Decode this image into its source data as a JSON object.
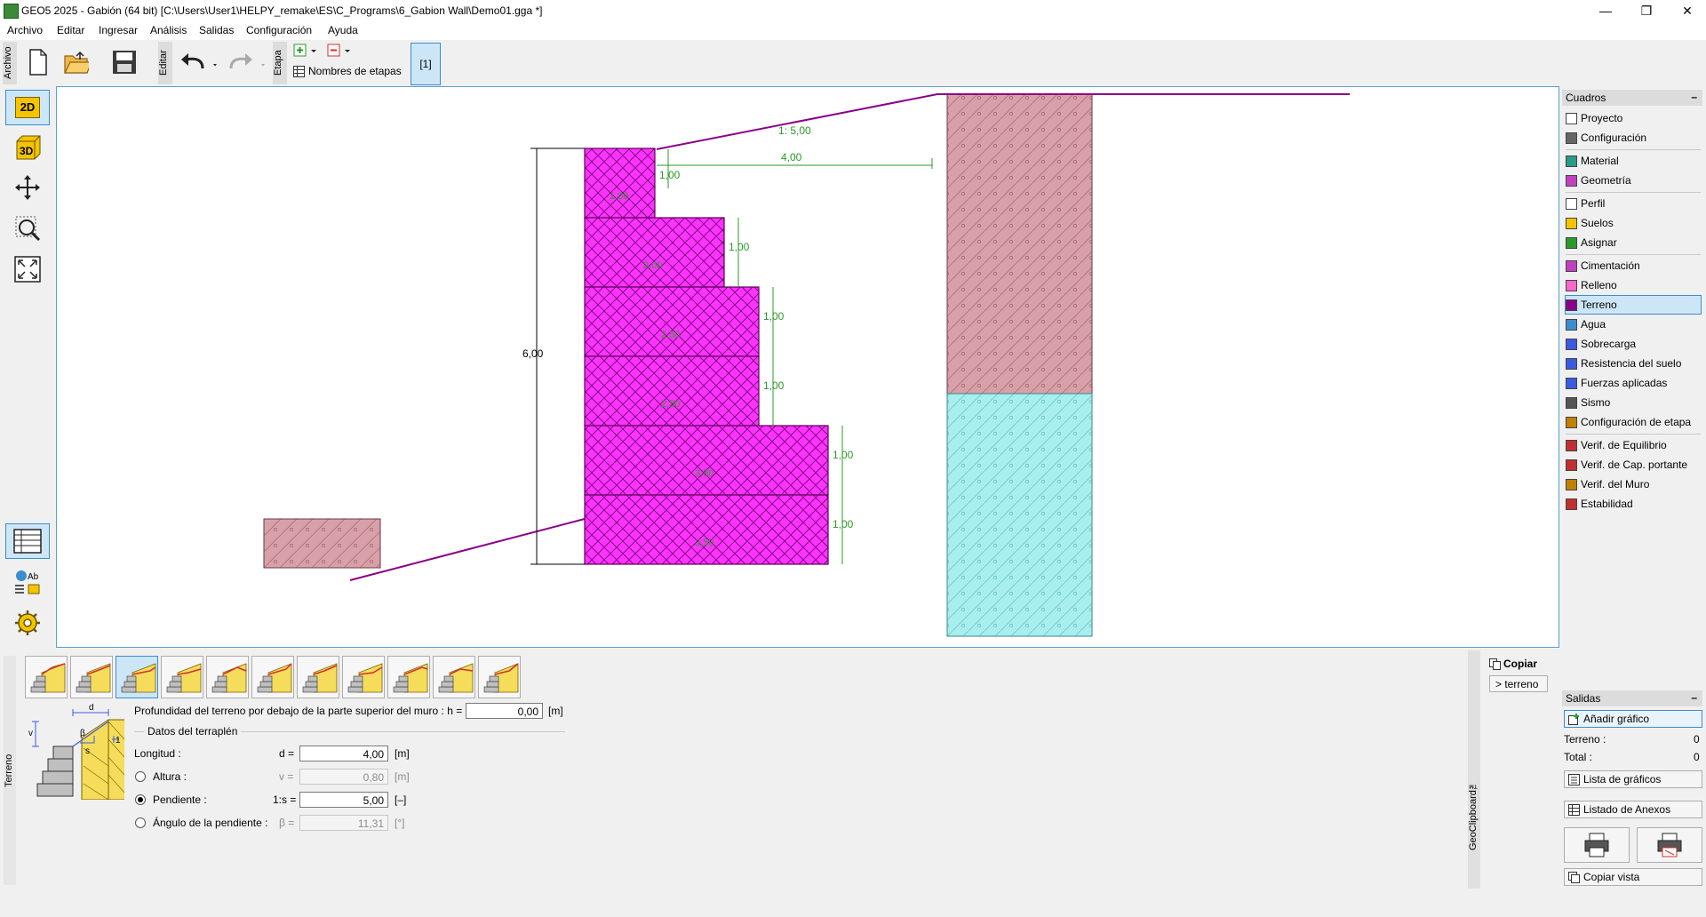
{
  "window": {
    "title": "GEO5 2025 - Gabión (64 bit) [C:\\Users\\User1\\HELPY_remake\\ES\\C_Programs\\6_Gabion Wall\\Demo01.gga *]"
  },
  "menu": [
    "Archivo",
    "Editar",
    "Ingresar",
    "Análisis",
    "Salidas",
    "Configuración",
    "Ayuda"
  ],
  "toolbar": {
    "archivo_label": "Archivo",
    "editar_label": "Editar",
    "etapa_label": "Etapa",
    "stage_names_label": "Nombres de etapas",
    "stage_tab": "[1]"
  },
  "leftbar": {
    "btn_2d": "2D",
    "btn_3d": "3D"
  },
  "drawing": {
    "slope_label": "1: 5,00",
    "length_label": "4,00",
    "total_height": "6,00",
    "step_heights": [
      "1,00",
      "1,00",
      "1,00",
      "1,00",
      "1,00",
      "1,00"
    ],
    "block_widths": [
      "1,00",
      "2,00",
      "2,50",
      "2,50",
      "3,50",
      "3,50"
    ]
  },
  "right_panel": {
    "cuadros_title": "Cuadros",
    "groups": [
      [
        {
          "label": "Proyecto",
          "icon": "project-icon"
        },
        {
          "label": "Configuración",
          "icon": "gear-icon"
        }
      ],
      [
        {
          "label": "Material",
          "icon": "material-icon"
        },
        {
          "label": "Geometría",
          "icon": "geometry-icon"
        }
      ],
      [
        {
          "label": "Perfil",
          "icon": "profile-icon"
        },
        {
          "label": "Suelos",
          "icon": "soils-icon"
        },
        {
          "label": "Asignar",
          "icon": "assign-icon"
        }
      ],
      [
        {
          "label": "Cimentación",
          "icon": "foundation-icon"
        },
        {
          "label": "Relleno",
          "icon": "backfill-icon"
        },
        {
          "label": "Terreno",
          "icon": "terrain-icon",
          "selected": true
        },
        {
          "label": "Agua",
          "icon": "water-icon"
        },
        {
          "label": "Sobrecarga",
          "icon": "surcharge-icon"
        },
        {
          "label": "Resistencia del suelo",
          "icon": "resistance-icon"
        },
        {
          "label": "Fuerzas aplicadas",
          "icon": "forces-icon"
        },
        {
          "label": "Sismo",
          "icon": "earthquake-icon"
        },
        {
          "label": "Configuración de etapa",
          "icon": "stage-settings-icon"
        }
      ],
      [
        {
          "label": "Verif. de Equilibrio",
          "icon": "equilibrium-icon"
        },
        {
          "label": "Verif. de Cap. portante",
          "icon": "bearing-icon"
        },
        {
          "label": "Verif. del Muro",
          "icon": "wall-check-icon"
        },
        {
          "label": "Estabilidad",
          "icon": "stability-icon"
        }
      ]
    ],
    "salidas_title": "Salidas",
    "add_graphic": "Añadir gráfico",
    "terreno_label": "Terreno :",
    "terreno_count": "0",
    "total_label": "Total :",
    "total_count": "0",
    "graphics_list": "Lista de gráficos",
    "annex_list": "Listado de Anexos",
    "copy_view": "Copiar vista"
  },
  "bottom": {
    "vertical_label": "Terreno",
    "depth_label": "Profundidad del terreno por debajo de la parte superior del muro : h =",
    "depth_value": "0,00",
    "depth_unit": "[m]",
    "section_title": "Datos del terraplén",
    "longitud_label": "Longitud :",
    "d_label": "d =",
    "d_value": "4,00",
    "d_unit": "[m]",
    "altura_label": "Altura :",
    "v_label": "v =",
    "v_value": "0,80",
    "v_unit": "[m]",
    "pendiente_label": "Pendiente :",
    "s_label": "1:s =",
    "s_value": "5,00",
    "s_unit": "[–]",
    "angulo_label": "Ángulo de la pendiente :",
    "beta_label": "β =",
    "beta_value": "11,31",
    "beta_unit": "[°]",
    "diagram_d": "d",
    "diagram_v": "v",
    "diagram_beta": "β",
    "diagram_s": "s",
    "diagram_1": "1",
    "copy_label": "Copiar",
    "terreno_btn": "> terreno",
    "geoclipboard": "GeoClipboard™"
  }
}
